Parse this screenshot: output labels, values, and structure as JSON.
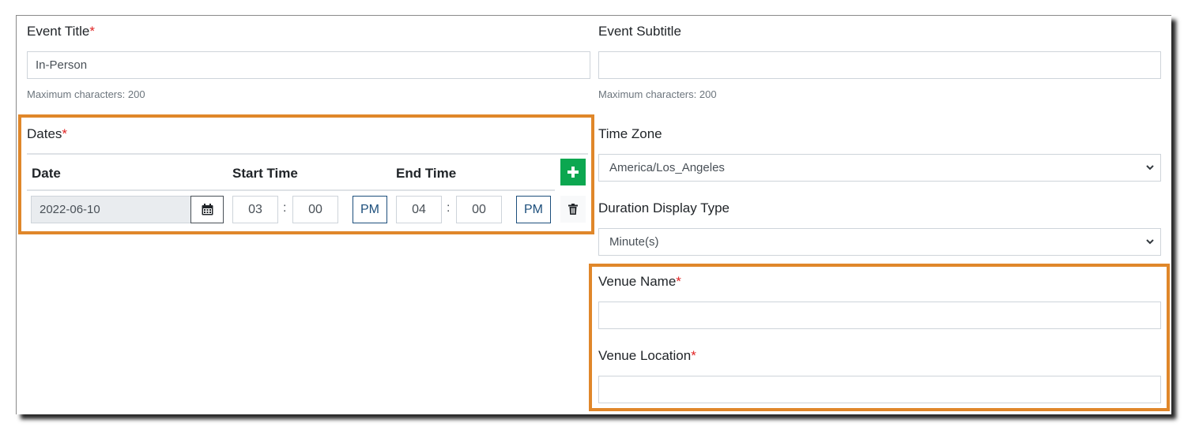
{
  "event_title": {
    "label": "Event Title",
    "required_mark": "*",
    "value": "In-Person",
    "help": "Maximum characters: 200"
  },
  "event_subtitle": {
    "label": "Event Subtitle",
    "value": "",
    "help": "Maximum characters: 200"
  },
  "dates": {
    "label": "Dates",
    "required_mark": "*",
    "columns": {
      "date": "Date",
      "start_time": "Start Time",
      "end_time": "End Time"
    },
    "add_icon": "plus-icon",
    "rows": [
      {
        "date": "2022-06-10",
        "calendar_icon": "calendar-icon",
        "start_hour": "03",
        "start_minute": "00",
        "start_ampm": "PM",
        "end_hour": "04",
        "end_minute": "00",
        "end_ampm": "PM",
        "separator": ":",
        "delete_icon": "trash-icon"
      }
    ]
  },
  "time_zone": {
    "label": "Time Zone",
    "selected": "America/Los_Angeles"
  },
  "duration_display_type": {
    "label": "Duration Display Type",
    "selected": "Minute(s)"
  },
  "venue_name": {
    "label": "Venue Name",
    "required_mark": "*",
    "value": ""
  },
  "venue_location": {
    "label": "Venue Location",
    "required_mark": "*",
    "value": ""
  },
  "colors": {
    "highlight": "#e0872a",
    "add_button": "#0ca750",
    "ampm_border": "#1d4f7c",
    "required": "#e02424"
  }
}
